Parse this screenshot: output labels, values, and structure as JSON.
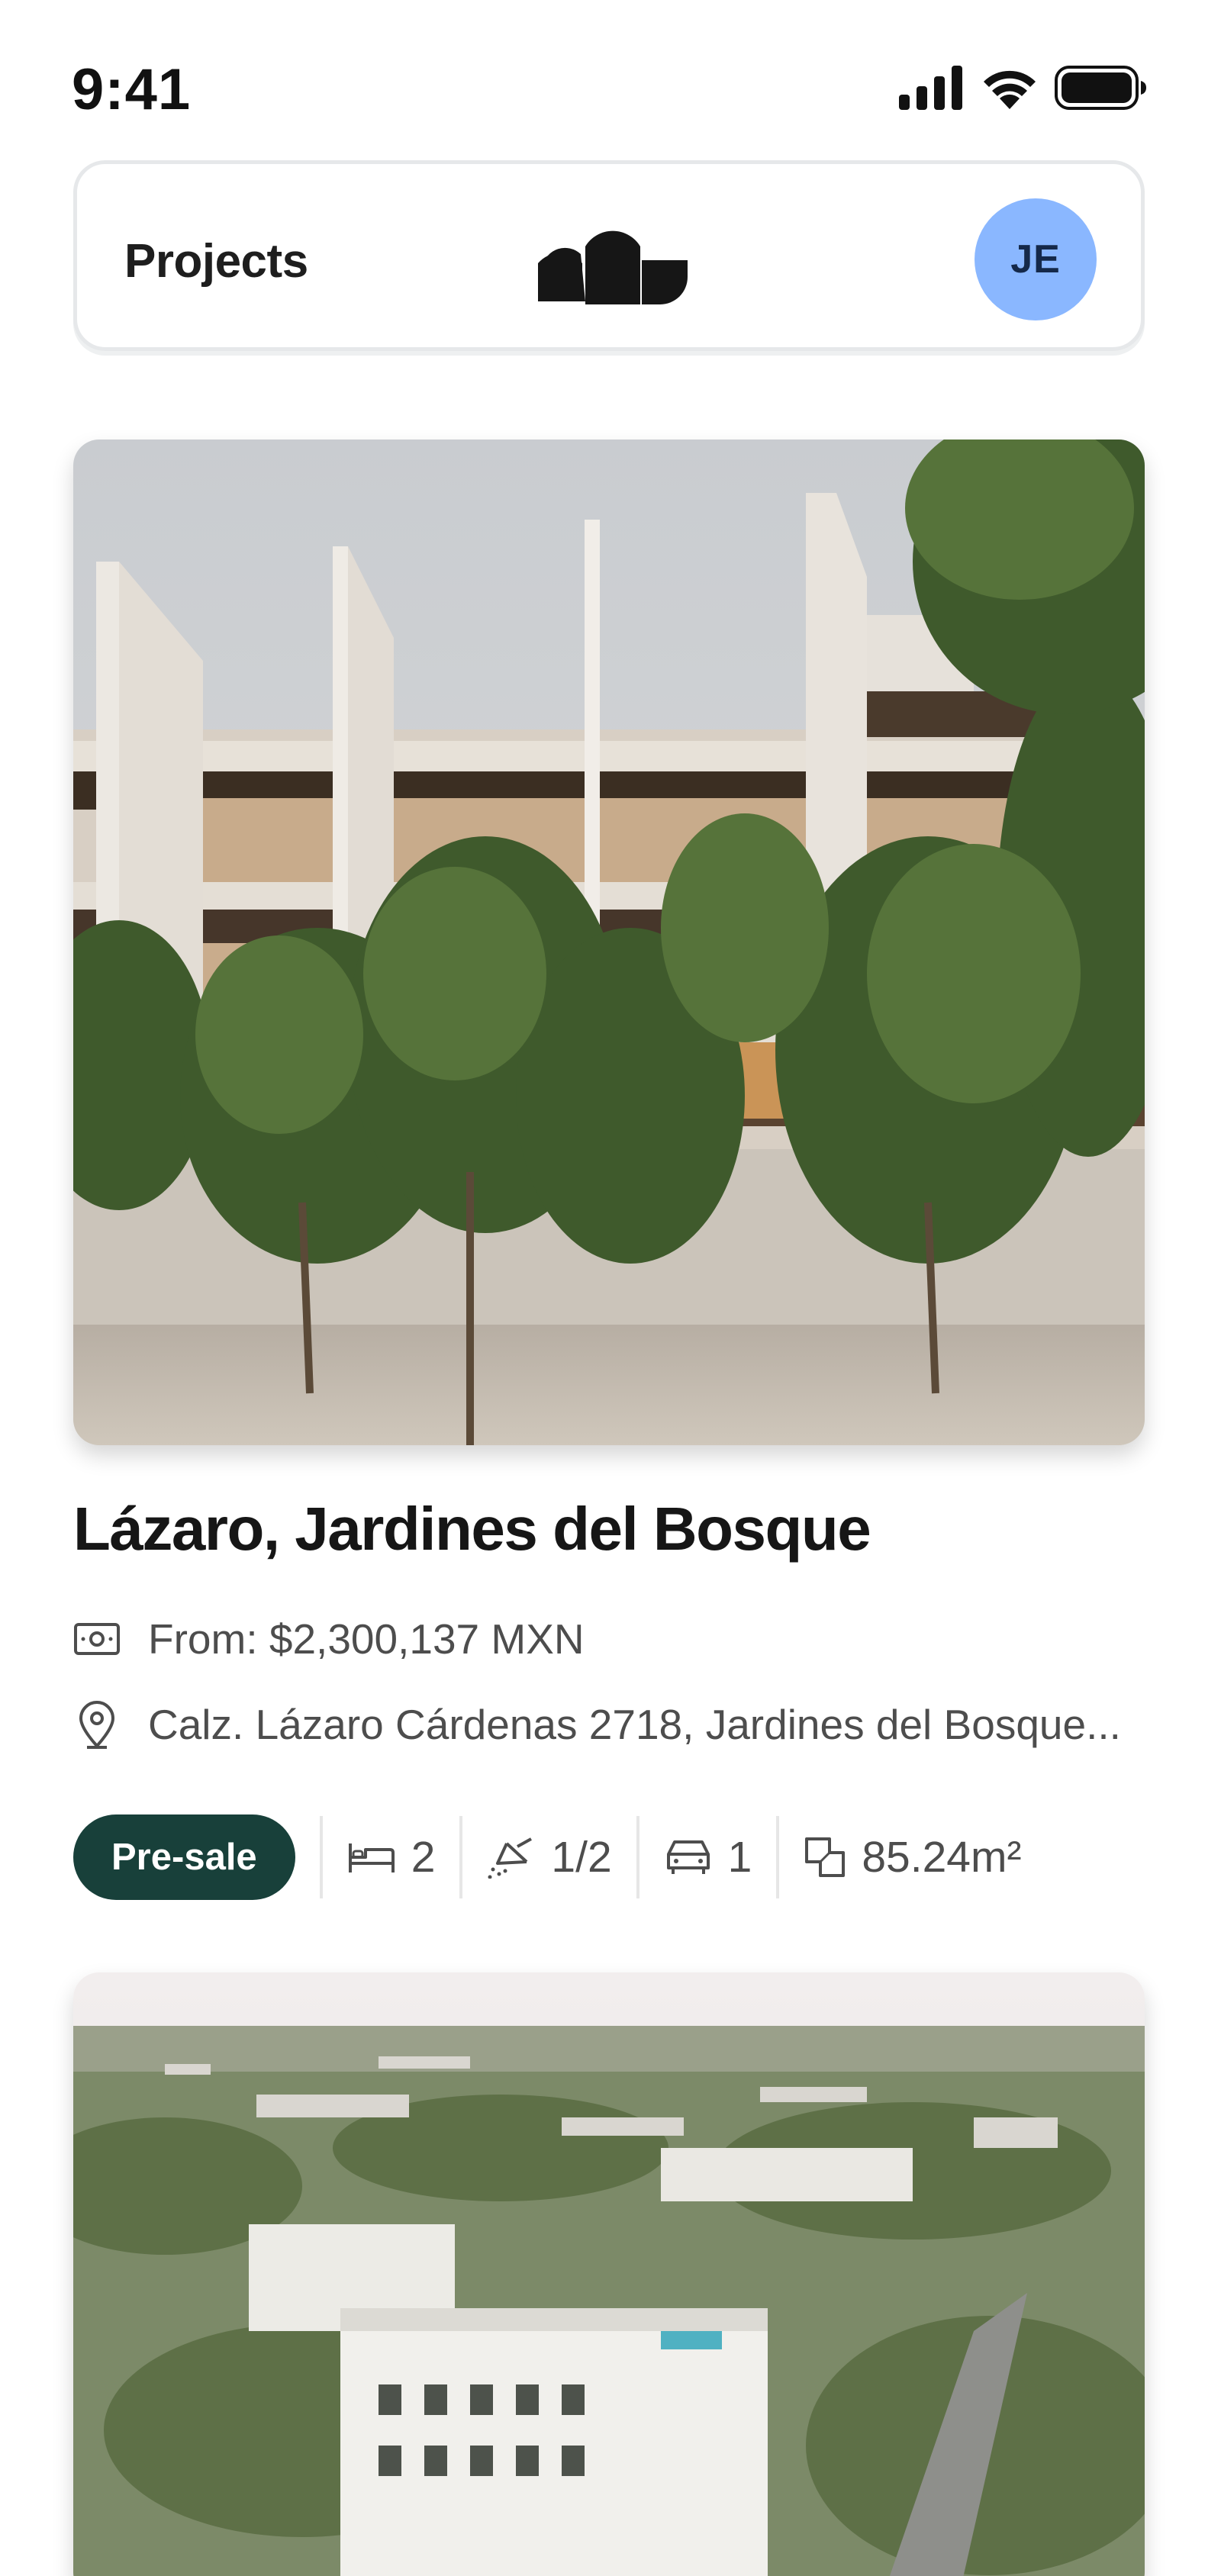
{
  "status_bar": {
    "time": "9:41"
  },
  "header": {
    "title": "Projects",
    "avatar_initials": "JE",
    "avatar_color": "#8ab7ff"
  },
  "projects": [
    {
      "title": "Lázaro, Jardines del Bosque",
      "price": "From: $2,300,137 MXN",
      "address": "Calz. Lázaro Cárdenas 2718, Jardines del Bosque...",
      "status_badge": "Pre-sale",
      "bedrooms": "2",
      "bathrooms": "1/2",
      "parking": "1",
      "area": "85.24m²"
    }
  ],
  "colors": {
    "badge_bg": "#18403a",
    "text_muted": "#4d4d4d",
    "border": "#e6e8ea"
  },
  "icons": [
    "signal-icon",
    "wifi-icon",
    "battery-icon",
    "logo-icon",
    "money-icon",
    "location-pin-icon",
    "bed-icon",
    "shower-icon",
    "car-icon",
    "area-icon"
  ]
}
